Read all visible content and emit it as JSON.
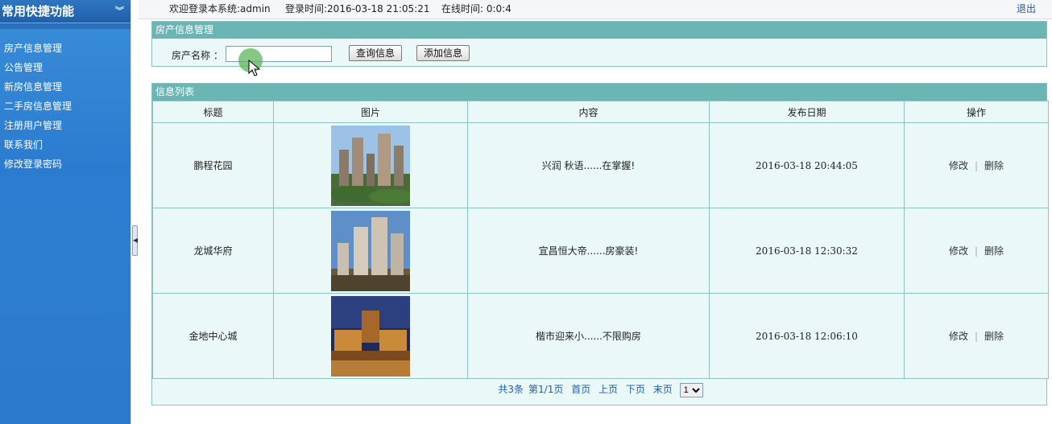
{
  "sidebar": {
    "title": "常用快捷功能",
    "items": [
      {
        "label": "房产信息管理"
      },
      {
        "label": "公告管理"
      },
      {
        "label": "新房信息管理"
      },
      {
        "label": "二手房信息管理"
      },
      {
        "label": "注册用户管理"
      },
      {
        "label": "联系我们"
      },
      {
        "label": "修改登录密码"
      }
    ]
  },
  "topbar": {
    "welcome": "欢迎登录本系统:admin",
    "login_time": "登录时间:2016-03-18 21:05:21",
    "online_time": "在线时间: 0:0:4",
    "logout": "退出"
  },
  "search": {
    "title": "房产信息管理",
    "label": "房产名称 ：",
    "value": "",
    "query_button": "查询信息",
    "add_button": "添加信息"
  },
  "list": {
    "title": "信息列表",
    "columns": [
      "标题",
      "图片",
      "内容",
      "发布日期",
      "操作"
    ],
    "rows": [
      {
        "title": "鹏程花园",
        "content": "兴润 秋语......在掌握!",
        "date": "2016-03-18 20:44:05",
        "edit": "修改",
        "delete": "删除"
      },
      {
        "title": "龙城华府",
        "content": "宜昌恒大帝......房豪装!",
        "date": "2016-03-18 12:30:32",
        "edit": "修改",
        "delete": "删除"
      },
      {
        "title": "金地中心城",
        "content": "楷市迎来小......不限购房",
        "date": "2016-03-18 12:06:10",
        "edit": "修改",
        "delete": "删除"
      }
    ]
  },
  "pager": {
    "total": "共3条",
    "page_info": "第1/1页",
    "first": "首页",
    "prev": "上页",
    "next": "下页",
    "last": "末页",
    "selected_page": "1"
  },
  "colors": {
    "sidebar_bg": "#2b7bd0",
    "panel_header": "#6bb5b5",
    "panel_bg": "#eaf8f8",
    "link": "#1a5fb4"
  }
}
